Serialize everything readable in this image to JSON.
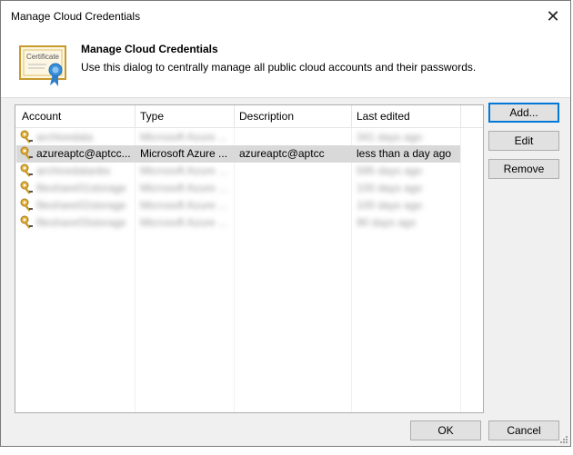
{
  "window": {
    "title": "Manage Cloud Credentials",
    "close_glyph": "✕"
  },
  "header": {
    "title": "Manage Cloud Credentials",
    "description": "Use this dialog to centrally manage all public cloud accounts and their passwords.",
    "icon": "certificate-icon",
    "icon_label": "Certificate"
  },
  "grid": {
    "columns": [
      "Account",
      "Type",
      "Description",
      "Last edited"
    ],
    "rows": [
      {
        "account": "archivedata",
        "type": "Microsoft Azure ...",
        "description": "",
        "last_edited": "341 days ago",
        "blurred": true,
        "selected": false
      },
      {
        "account": "azureaptc@aptcc...",
        "type": "Microsoft Azure ...",
        "description": "azureaptc@aptcc",
        "last_edited": "less than a day ago",
        "blurred": false,
        "selected": true
      },
      {
        "account": "archivedatanbs",
        "type": "Microsoft Azure ...",
        "description": "",
        "last_edited": "595 days ago",
        "blurred": true,
        "selected": false
      },
      {
        "account": "fileshare01storage",
        "type": "Microsoft Azure ...",
        "description": "",
        "last_edited": "100 days ago",
        "blurred": true,
        "selected": false
      },
      {
        "account": "fileshare02storage",
        "type": "Microsoft Azure ...",
        "description": "",
        "last_edited": "100 days ago",
        "blurred": true,
        "selected": false
      },
      {
        "account": "fileshare03storage",
        "type": "Microsoft Azure ...",
        "description": "",
        "last_edited": "90 days ago",
        "blurred": true,
        "selected": false
      }
    ]
  },
  "buttons": {
    "add": "Add...",
    "edit": "Edit",
    "remove": "Remove",
    "ok": "OK",
    "cancel": "Cancel"
  },
  "colors": {
    "accent": "#0078d7",
    "selection": "#d9d9d9",
    "key_gold": "#c89a2e"
  }
}
